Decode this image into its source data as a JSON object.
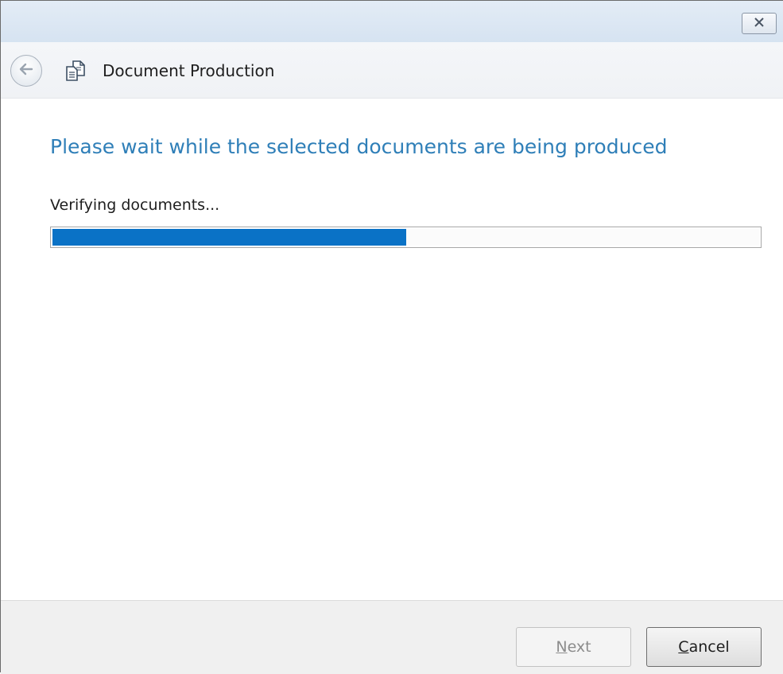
{
  "window": {
    "close_icon": "close-icon"
  },
  "header": {
    "back_icon": "back-arrow-icon",
    "app_icon": "document-production-icon",
    "title": "Document Production"
  },
  "main": {
    "heading": "Please wait while the selected documents are being produced",
    "status": "Verifying documents...",
    "progress_fraction": 0.5,
    "colors": {
      "heading": "#2f7fb8",
      "progress_fill": "#0a72c6"
    }
  },
  "footer": {
    "next": {
      "accel": "N",
      "rest": "ext",
      "enabled": false
    },
    "cancel": {
      "accel": "C",
      "rest": "ancel",
      "enabled": true
    }
  }
}
